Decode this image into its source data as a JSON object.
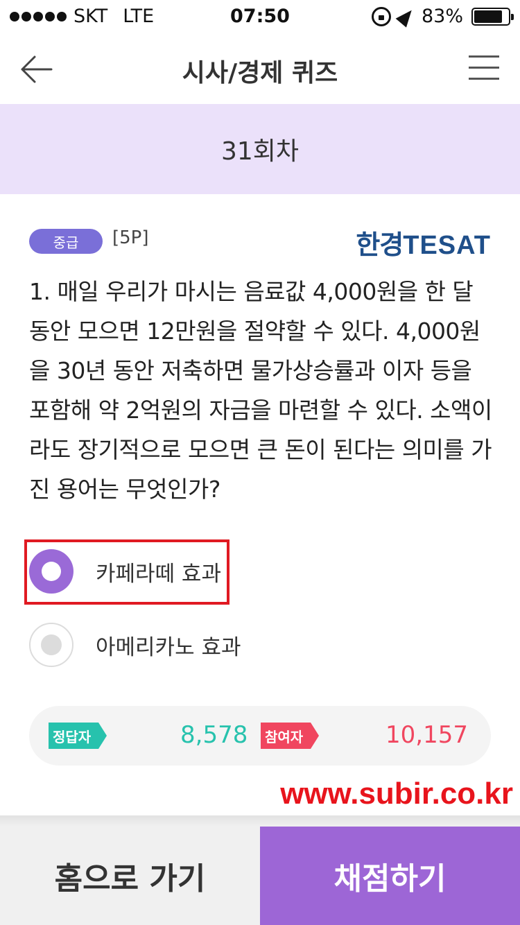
{
  "status_bar": {
    "carrier": "SKT",
    "network": "LTE",
    "time": "07:50",
    "battery": "83%",
    "icons": [
      "signal-dots-icon",
      "rotation-lock-icon",
      "location-arrow-icon",
      "battery-icon"
    ]
  },
  "header": {
    "title": "시사/경제 퀴즈",
    "back_icon": "back-arrow-icon",
    "menu_icon": "hamburger-menu-icon"
  },
  "round": {
    "label": "31회차"
  },
  "question": {
    "level": "중급",
    "points": "[5P]",
    "logo_ko": "한경",
    "logo_en": "TESAT",
    "text": "1. 매일 우리가 마시는 음료값 4,000원을 한 달 동안 모으면 12만원을 절약할 수 있다. 4,000원을 30년 동안 저축하면 물가상승률과 이자 등을 포함해 약 2억원의 자금을 마련할 수 있다. 소액이라도 장기적으로 모으면 큰 돈이 된다는 의미를 가진 용어는 무엇인가?"
  },
  "options": [
    {
      "label": "카페라떼 효과",
      "selected": true
    },
    {
      "label": "아메리카노 효과",
      "selected": false
    }
  ],
  "stats": {
    "correct_label": "정답자",
    "correct_count": "8,578",
    "participants_label": "참여자",
    "participants_count": "10,157"
  },
  "watermark": "www.subir.co.kr",
  "buttons": {
    "home": "홈으로 가기",
    "grade": "채점하기"
  },
  "colors": {
    "accent_purple": "#9d66d6",
    "banner_lavender": "#ebe1fa",
    "correct_teal": "#27c2ad",
    "participants_red": "#f0465f",
    "highlight_red": "#e01a22"
  }
}
